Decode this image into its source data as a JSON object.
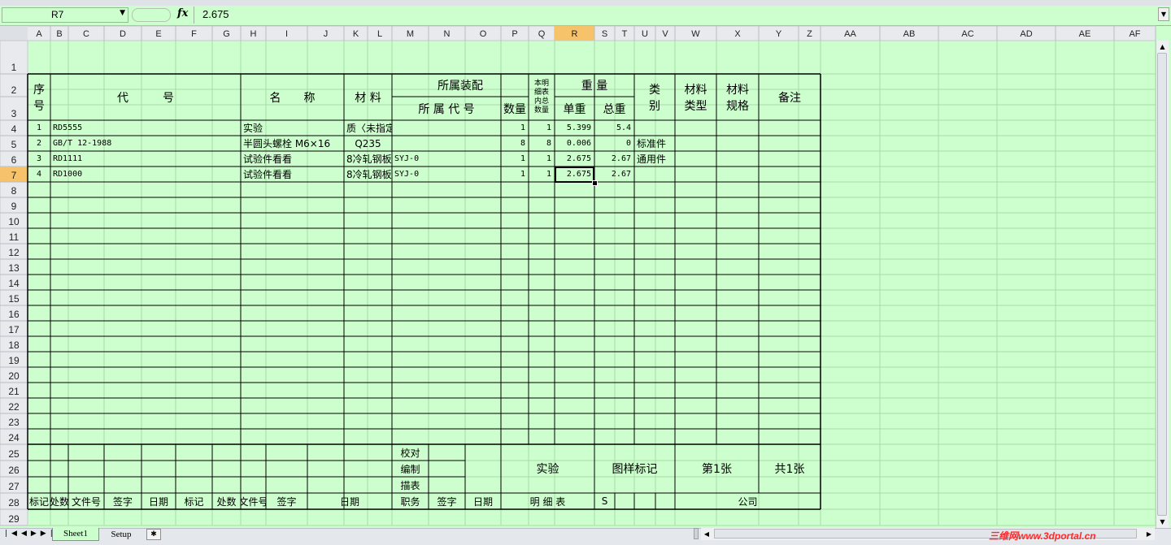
{
  "formula_bar": {
    "name_box": "R7",
    "fx": "fx",
    "value": "2.675"
  },
  "columns": [
    "A",
    "B",
    "C",
    "D",
    "E",
    "F",
    "G",
    "H",
    "I",
    "J",
    "K",
    "L",
    "M",
    "N",
    "O",
    "P",
    "Q",
    "R",
    "S",
    "T",
    "U",
    "V",
    "W",
    "X",
    "Y",
    "Z",
    "AA",
    "AB",
    "AC",
    "AD",
    "AE",
    "AF"
  ],
  "rows": [
    "1",
    "2",
    "3",
    "4",
    "5",
    "6",
    "7",
    "8",
    "9",
    "10",
    "11",
    "12",
    "13",
    "14",
    "15",
    "16",
    "17",
    "18",
    "19",
    "20",
    "21",
    "22",
    "23",
    "24",
    "25",
    "26",
    "27",
    "28",
    "29"
  ],
  "selected_cell": "R7",
  "headers": {
    "seq": "序号",
    "code": "代　　　号",
    "name": "名　　称",
    "material": "材 料",
    "assembly": "所属装配",
    "assembly_code": "所 属 代 号",
    "qty": "数量",
    "total_in_list": "本明细表内总数量",
    "weight": "重 量",
    "unit_weight": "单重",
    "total_weight": "总重",
    "category": "类别",
    "mat_type": "材料类型",
    "mat_spec": "材料规格",
    "remark": "备注"
  },
  "data_rows": [
    {
      "seq": "1",
      "code": "RD5555",
      "name": "实验",
      "material": "质〈未指定",
      "asm_code": "",
      "qty": "1",
      "total": "1",
      "unit": "5.399",
      "tw": "5.4",
      "cat": ""
    },
    {
      "seq": "2",
      "code": "GB/T 12-1988",
      "name": "半圆头螺栓 M6×16",
      "material": "Q235",
      "asm_code": "",
      "qty": "8",
      "total": "8",
      "unit": "0.006",
      "tw": "0",
      "cat": "标准件"
    },
    {
      "seq": "3",
      "code": "RD1111",
      "name": "试验件看看",
      "material": "8冷轧钢板",
      "asm_code": "SYJ-0",
      "qty": "1",
      "total": "1",
      "unit": "2.675",
      "tw": "2.67",
      "cat": "通用件"
    },
    {
      "seq": "4",
      "code": "RD1000",
      "name": "试验件看看",
      "material": "8冷轧钢板",
      "asm_code": "SYJ-0",
      "qty": "1",
      "total": "1",
      "unit": "2.675",
      "tw": "2.67",
      "cat": ""
    }
  ],
  "footer": {
    "check": "校对",
    "compile": "编制",
    "draw": "描表",
    "company_name": "实验",
    "mark_label": "图样标记",
    "sheet_no": "第1张",
    "sheet_total": "共1张",
    "mark": "标记",
    "places": "处数",
    "doc_no": "文件号",
    "sign": "签字",
    "date": "日期",
    "mark2": "标记",
    "places2": "处数",
    "doc_no2": "文件号",
    "sign2": "签字",
    "date2": "日期",
    "post": "职务",
    "sign3": "签字",
    "date3": "日期",
    "list_title": "明 细 表",
    "s": "S",
    "company": "公司"
  },
  "tabs": [
    "Sheet1",
    "Setup"
  ],
  "watermark": "三维网www.3dportal.cn",
  "colors": {
    "sheet_bg": "#cdfecd",
    "header_bg": "#e8eaee",
    "grid": "#a9dca9",
    "selected_header": "#f6c36b"
  }
}
